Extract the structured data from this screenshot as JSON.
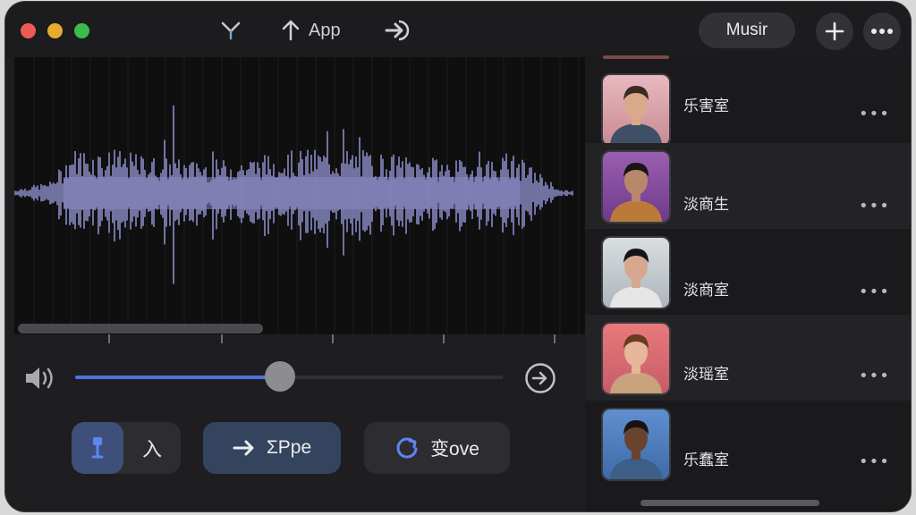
{
  "titlebar": {
    "app_label": "App",
    "primary_button": "Musir"
  },
  "transport": {
    "volume_progress": 0.48
  },
  "bottom_bar": {
    "segment_right_label": "入",
    "type_button_label": "ΣPpe",
    "save_button_label": "变ove"
  },
  "list": {
    "items": [
      {
        "name": "乐害室",
        "more": "•••",
        "bg_top": "#e8b9bf",
        "bg_bottom": "#c98a92",
        "skin": "#d9a98a",
        "hair": "#3a2a22",
        "shirt": "#3f4f66"
      },
      {
        "name": "淡商生",
        "more": "•••",
        "bg_top": "#9a5fb0",
        "bg_bottom": "#6f3a8a",
        "skin": "#b9876a",
        "hair": "#1b1414",
        "shirt": "#b97a3a"
      },
      {
        "name": "淡商室",
        "more": "•••",
        "bg_top": "#d8dde0",
        "bg_bottom": "#aeb6bb",
        "skin": "#d6a88f",
        "hair": "#151515",
        "shirt": "#e6e6e6"
      },
      {
        "name": "淡瑶室",
        "more": "•••",
        "bg_top": "#e87a7a",
        "bg_bottom": "#c75b6a",
        "skin": "#e6b59a",
        "hair": "#6a3a22",
        "shirt": "#c9a27e"
      },
      {
        "name": "乐蠢室",
        "more": "•••",
        "bg_top": "#5f8fd0",
        "bg_bottom": "#3f6aa8",
        "skin": "#6a4330",
        "hair": "#1a120e",
        "shirt": "#3d5f86"
      }
    ]
  },
  "colors": {
    "waveform": "#8a8ac4",
    "accent": "#4d74e0"
  }
}
